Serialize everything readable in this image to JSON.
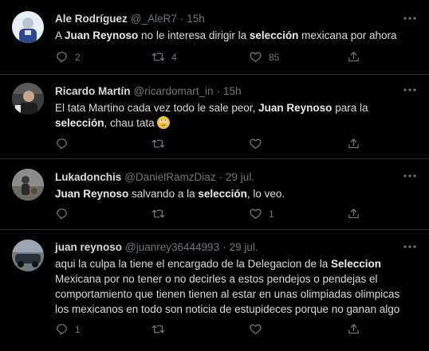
{
  "tweets": [
    {
      "name": "Ale Rodríguez",
      "handle": "@_AleR7",
      "time": "15h",
      "segments": [
        {
          "t": "A ",
          "b": false
        },
        {
          "t": "Juan Reynoso",
          "b": true
        },
        {
          "t": " no le interesa dirigir la ",
          "b": false
        },
        {
          "t": "selección",
          "b": true
        },
        {
          "t": " mexicana por ahora",
          "b": false
        }
      ],
      "replies": "2",
      "retweets": "4",
      "likes": "85"
    },
    {
      "name": "Ricardo Martín",
      "handle": "@ricardomart_in",
      "time": "15h",
      "segments": [
        {
          "t": "El tata Martino cada vez todo le sale peor, ",
          "b": false
        },
        {
          "t": "Juan Reynoso",
          "b": true
        },
        {
          "t": " para la ",
          "b": false
        },
        {
          "t": "selección",
          "b": true
        },
        {
          "t": ", chau tata ",
          "b": false
        }
      ],
      "emoji": "face-with-rolling-eyes",
      "replies": "",
      "retweets": "",
      "likes": ""
    },
    {
      "name": "Lukadonchis",
      "handle": "@DanielRamzDiaz",
      "time": "29 jul.",
      "segments": [
        {
          "t": "Juan Reynoso",
          "b": true
        },
        {
          "t": " salvando a la ",
          "b": false
        },
        {
          "t": "selección",
          "b": true
        },
        {
          "t": ", lo veo.",
          "b": false
        }
      ],
      "replies": "",
      "retweets": "",
      "likes": "1"
    },
    {
      "name": "juan reynoso",
      "handle": "@juanrey36444993",
      "time": "29 jul.",
      "segments": [
        {
          "t": "aqui la culpa la tiene el encargado de la Delegacion de la ",
          "b": false
        },
        {
          "t": "Seleccion",
          "b": true
        },
        {
          "t": " Mexicana por no tener o no decirles a estos pendejos o pendejas el comportamiento que tienen tienen al estar en unas olimpiadas olimpicas los mexicanos en todo son noticia de estupideces porque no ganan algo",
          "b": false
        }
      ],
      "replies": "1",
      "retweets": "",
      "likes": ""
    }
  ],
  "separator": "·",
  "icons": {
    "more": "more-icon",
    "reply": "reply-icon",
    "retweet": "retweet-icon",
    "like": "heart-icon",
    "share": "share-icon"
  },
  "colors": {
    "background": "#000000",
    "text": "#d9d9d9",
    "muted": "#6e767d",
    "divider": "#2f3336"
  }
}
